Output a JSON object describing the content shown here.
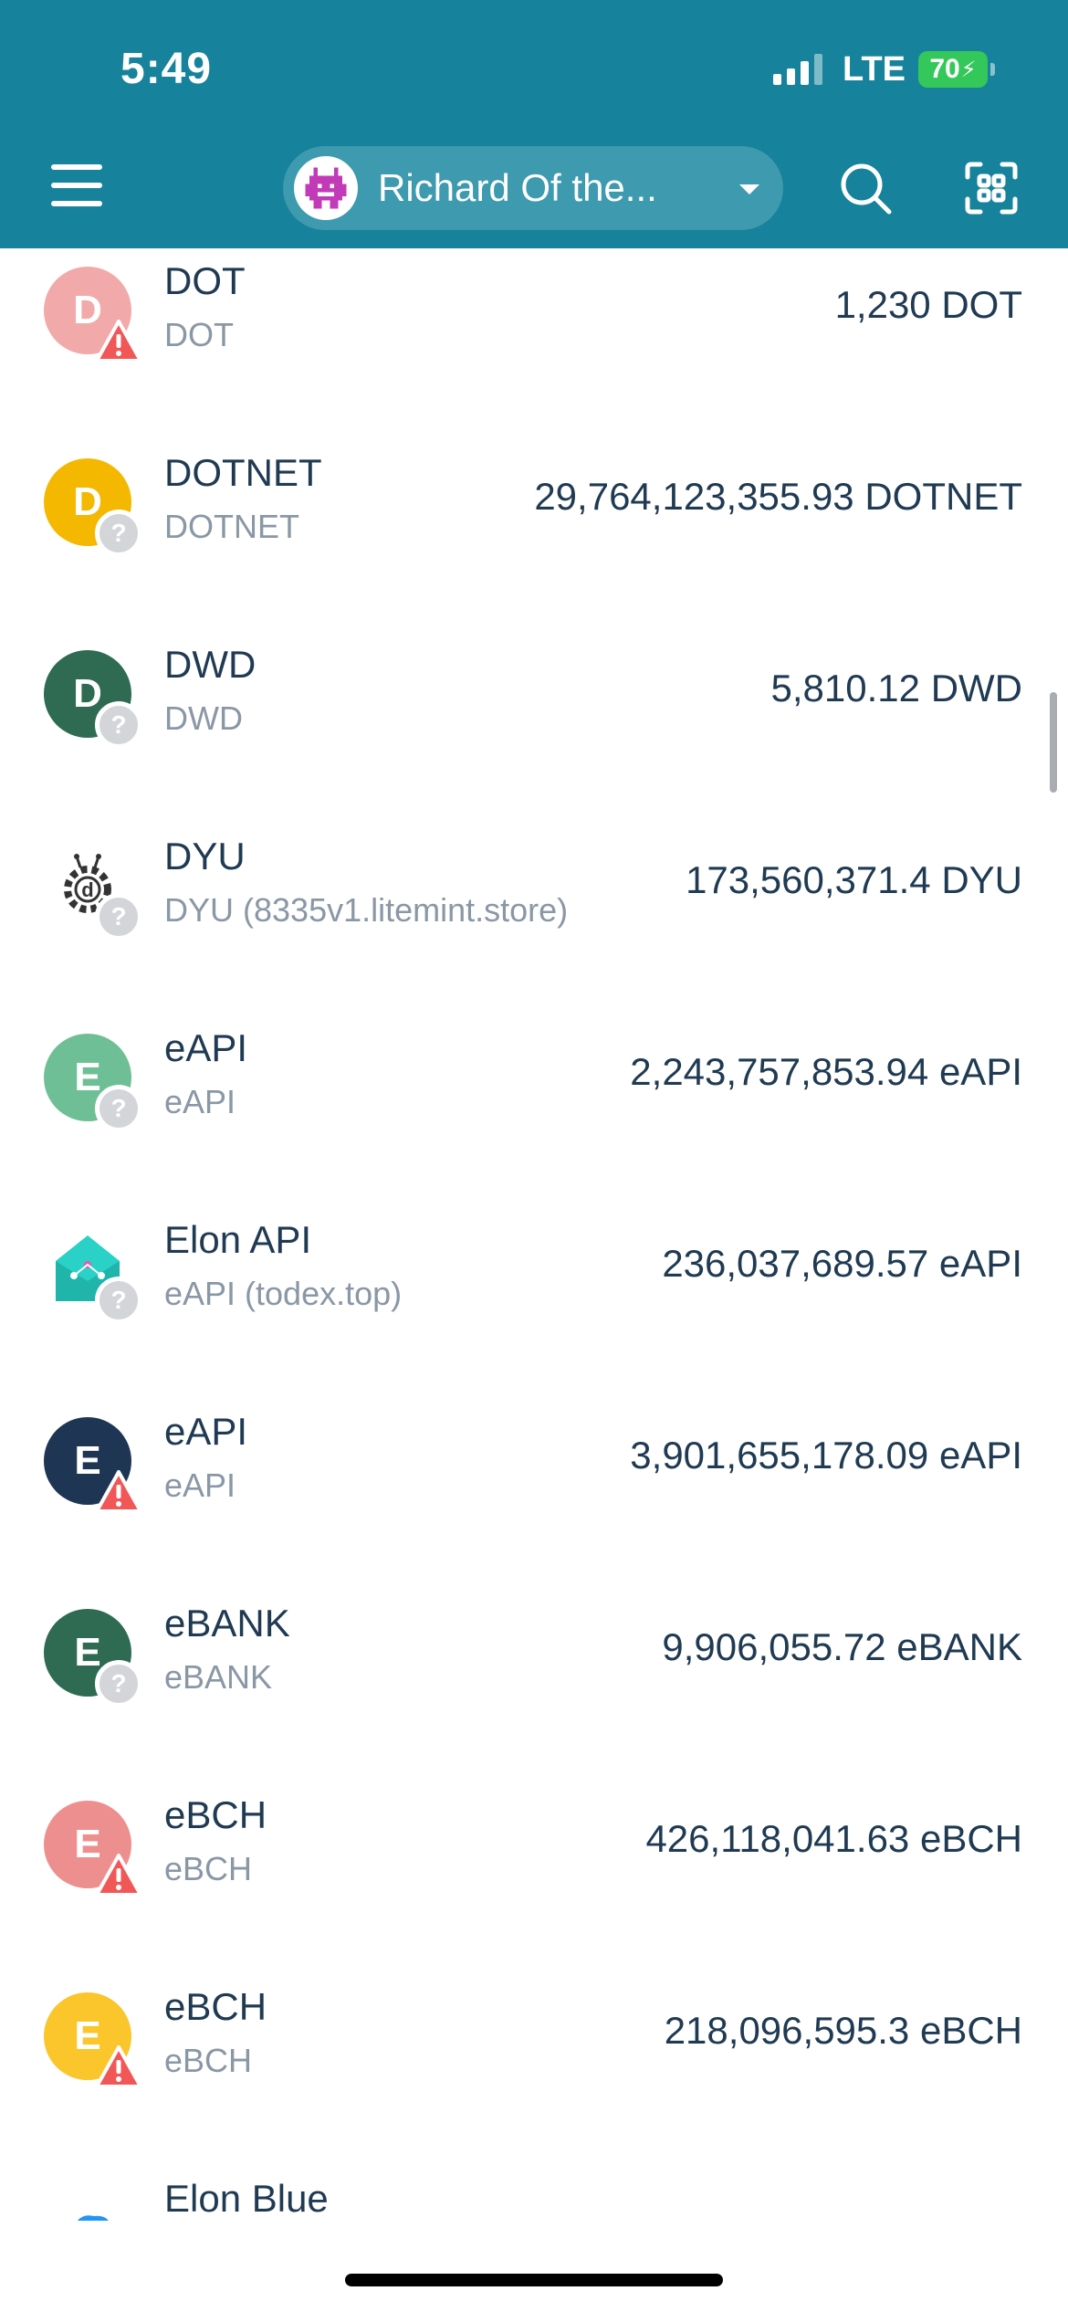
{
  "status_bar": {
    "time": "5:49",
    "network": "LTE",
    "battery": "70"
  },
  "header": {
    "wallet_name": "Richard Of the..."
  },
  "colors": {
    "header": "#17829b",
    "pill": "#3e9aae",
    "text": "#1f3a52",
    "subtext": "#8a97a5"
  },
  "tokens": [
    {
      "name": "DOT",
      "subtitle": "DOT",
      "balance": "1,230 DOT",
      "letter": "D",
      "icon_color": "#f2a9a9",
      "badge": "warning"
    },
    {
      "name": "DOTNET",
      "subtitle": "DOTNET",
      "balance": "29,764,123,355.93 DOTNET",
      "letter": "D",
      "icon_color": "#f5b800",
      "badge": "unknown"
    },
    {
      "name": "DWD",
      "subtitle": "DWD",
      "balance": "5,810.12 DWD",
      "letter": "D",
      "icon_color": "#2f6b52",
      "badge": "unknown"
    },
    {
      "name": "DYU",
      "subtitle": "DYU (8335v1.litemint.store)",
      "balance": "173,560,371.4 DYU",
      "letter": "d",
      "icon_color": "#ffffff",
      "badge": "unknown",
      "icon": "gear-logo-icon"
    },
    {
      "name": "eAPI",
      "subtitle": "eAPI",
      "balance": "2,243,757,853.94 eAPI",
      "letter": "E",
      "icon_color": "#6fbf96",
      "badge": "unknown"
    },
    {
      "name": "Elon API",
      "subtitle": "eAPI (todex.top)",
      "balance": "236,037,689.57 eAPI",
      "letter": "",
      "icon_color": "#ffffff",
      "badge": "unknown",
      "icon": "envelope-logo-icon"
    },
    {
      "name": "eAPI",
      "subtitle": "eAPI",
      "balance": "3,901,655,178.09 eAPI",
      "letter": "E",
      "icon_color": "#1f3554",
      "badge": "warning"
    },
    {
      "name": "eBANK",
      "subtitle": "eBANK",
      "balance": "9,906,055.72 eBANK",
      "letter": "E",
      "icon_color": "#2f6b52",
      "badge": "unknown"
    },
    {
      "name": "eBCH",
      "subtitle": "eBCH",
      "balance": "426,118,041.63 eBCH",
      "letter": "E",
      "icon_color": "#ee8f8f",
      "badge": "warning"
    },
    {
      "name": "eBCH",
      "subtitle": "eBCH",
      "balance": "218,096,595.3 eBCH",
      "letter": "E",
      "icon_color": "#fbc52c",
      "badge": "warning"
    },
    {
      "name": "Elon Blue",
      "subtitle": "",
      "balance": "",
      "letter": "",
      "icon_color": "#ffffff",
      "badge": "none",
      "icon": "cloud-logo-icon"
    }
  ]
}
